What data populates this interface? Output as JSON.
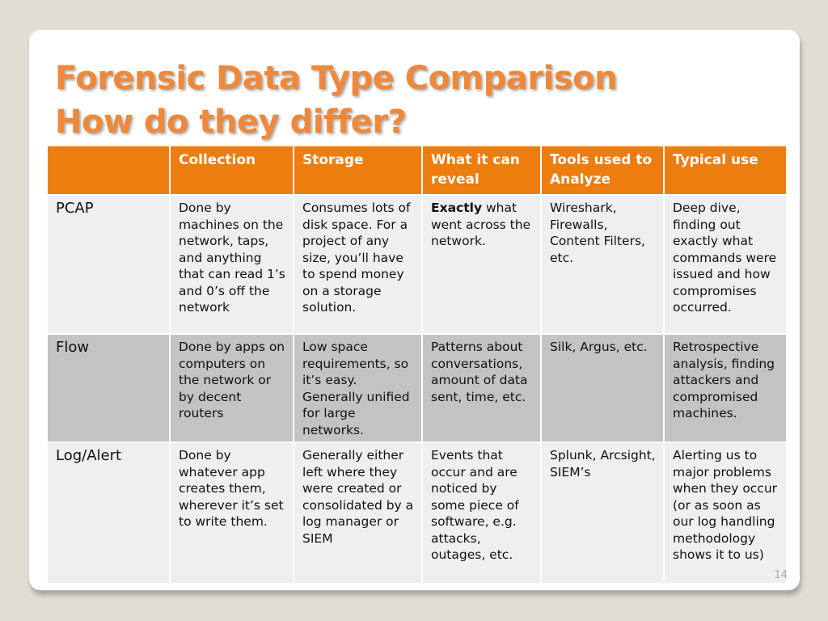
{
  "slide": {
    "title_line1": "Forensic Data Type Comparison",
    "title_line2": "How do they differ?",
    "page_number": "14",
    "accent_color": "#ed7d0e",
    "title_color": "#f0883a"
  },
  "table": {
    "headers": [
      "",
      "Collection",
      "Storage",
      "What it can reveal",
      "Tools used to Analyze",
      "Typical use"
    ],
    "rows": [
      {
        "type": "PCAP",
        "collection": "Done by machines on the network, taps, and anything that can read 1’s and 0’s off the network",
        "storage": "Consumes lots of disk space. For a project of any size, you’ll have to spend money on a storage solution.",
        "reveal_bold": "Exactly",
        "reveal": " what went across the network.",
        "tools": "Wireshark, Firewalls, Content Filters, etc.",
        "typical_use": "Deep dive, finding out exactly what commands were issued and how compromises occurred."
      },
      {
        "type": "Flow",
        "collection": "Done by apps on computers on the network or by decent routers",
        "storage": "Low space requirements, so it’s easy. Generally unified for large networks.",
        "reveal_bold": "",
        "reveal": "Patterns about conversations, amount of data sent, time, etc.",
        "tools": "Silk, Argus, etc.",
        "typical_use": "Retrospective analysis, finding attackers and compromised machines."
      },
      {
        "type": "Log/Alert",
        "collection": "Done by whatever app creates them, wherever it’s set to write them.",
        "storage": "Generally either left where they were created or consolidated by a log manager or SIEM",
        "reveal_bold": "",
        "reveal": "Events that occur and are noticed by some piece of software, e.g. attacks, outages, etc.",
        "tools": "Splunk, Arcsight, SIEM’s",
        "typical_use": "Alerting us to major problems when they occur (or as soon as our log handling methodology shows it to us)"
      }
    ]
  }
}
